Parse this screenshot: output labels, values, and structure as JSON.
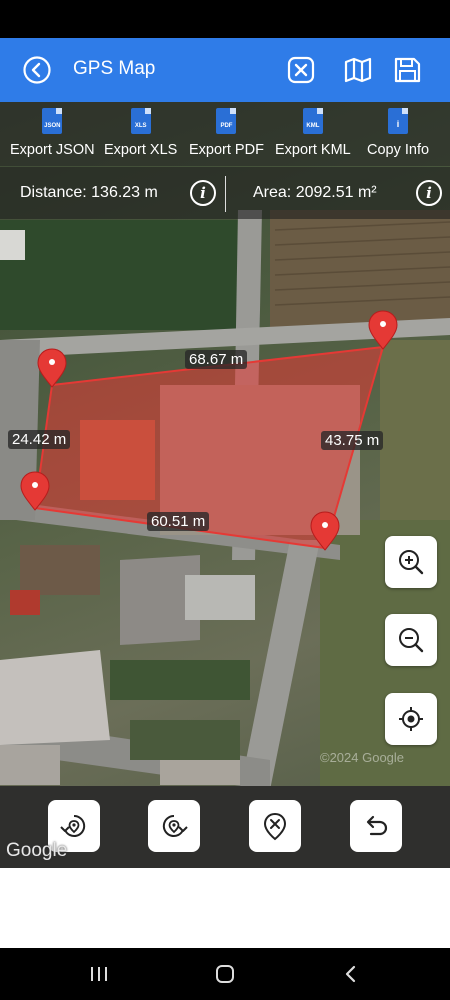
{
  "app_bar": {
    "title": "GPS Map",
    "accent_color": "#2f7ce8",
    "icons": [
      "back-icon",
      "close-icon",
      "map-icon",
      "save-icon"
    ]
  },
  "exports": [
    {
      "badge": "JSON",
      "label": "Export JSON"
    },
    {
      "badge": "XLS",
      "label": "Export XLS"
    },
    {
      "badge": "PDF",
      "label": "Export PDF"
    },
    {
      "badge": "KML",
      "label": "Export KML"
    },
    {
      "badge": "i",
      "label": "Copy Info"
    }
  ],
  "info": {
    "distance": "Distance: 136.23 m",
    "area": "Area: 2092.51 m²"
  },
  "polygon": {
    "fill_color": "#e53935",
    "edges": {
      "top": "68.67 m",
      "left": "24.42 m",
      "right": "43.75 m",
      "bottom": "60.51 m"
    }
  },
  "map_controls": [
    "zoom-in-icon",
    "zoom-out-icon",
    "my-location-icon"
  ],
  "bottom_tools": [
    "rotate-left-icon",
    "rotate-right-icon",
    "clear-icon",
    "undo-icon"
  ],
  "map": {
    "attribution": "Google",
    "watermark": "©2024 Google"
  },
  "system_nav": [
    "recent-apps-icon",
    "home-icon",
    "back-nav-icon"
  ]
}
